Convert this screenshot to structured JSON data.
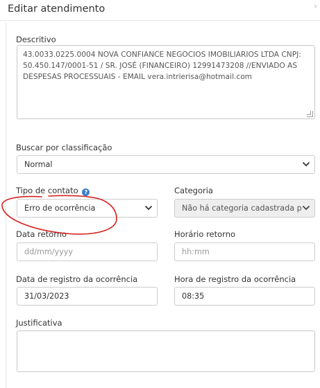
{
  "header": {
    "title": "Editar atendimento"
  },
  "form": {
    "descritivo": {
      "label": "Descritivo",
      "lines": [
        "43.0033.0225.0004 NOVA CONFIANCE NEGOCIOS IMOBILIARIOS LTDA CNPJ:",
        "50.450.147/0001-51 / SR. JOSÉ (FINANCEIRO) 12991473208 //ENVIADO AS",
        "DESPESAS PROCESSUAIS - EMAIL vera.intrierisa@hotmail.com"
      ]
    },
    "buscar": {
      "label": "Buscar por classificação",
      "value": "Normal"
    },
    "tipo_contato": {
      "label": "Tipo de contato",
      "help_icon": "question-circle-icon",
      "value": "Erro de ocorrência"
    },
    "categoria": {
      "label": "Categoria",
      "value": "Não há categoria cadastrada par"
    },
    "data_retorno": {
      "label": "Data retorno",
      "placeholder": "dd/mm/yyyy"
    },
    "horario_retorno": {
      "label": "Horário retorno",
      "placeholder": "hh:mm"
    },
    "data_registro": {
      "label": "Data de registro da ocorrência",
      "value": "31/03/2023"
    },
    "hora_registro": {
      "label": "Hora de registro da ocorrência",
      "value": "08:35"
    },
    "justificativa": {
      "label": "Justificativa"
    }
  },
  "colors": {
    "annotation": "#d42020",
    "help_icon": "#3a7fc8"
  }
}
